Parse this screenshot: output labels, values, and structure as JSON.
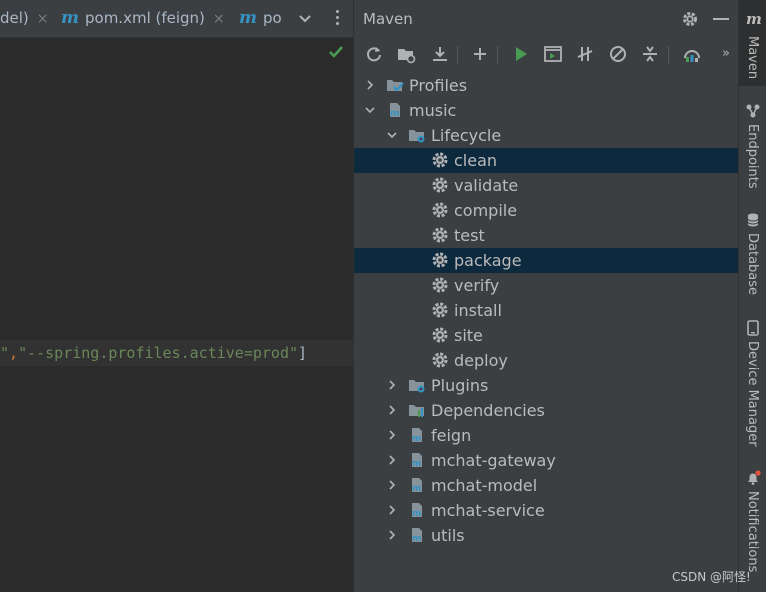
{
  "editor": {
    "tabs": [
      {
        "label": "del)",
        "close": "×"
      },
      {
        "logo": "m",
        "label": "pom.xml (feign)",
        "close": "×"
      },
      {
        "logo": "m",
        "label": "po"
      }
    ],
    "code_line": {
      "part1": "\"",
      "part2": ",",
      "part3": "\"--spring.profiles.active=prod\"",
      "part4": "]"
    }
  },
  "maven": {
    "title": "Maven",
    "toolbar_more": "»",
    "tree": [
      {
        "label": "Profiles"
      },
      {
        "label": "music"
      },
      {
        "label": "Lifecycle"
      },
      {
        "label": "clean"
      },
      {
        "label": "validate"
      },
      {
        "label": "compile"
      },
      {
        "label": "test"
      },
      {
        "label": "package"
      },
      {
        "label": "verify"
      },
      {
        "label": "install"
      },
      {
        "label": "site"
      },
      {
        "label": "deploy"
      },
      {
        "label": "Plugins"
      },
      {
        "label": "Dependencies"
      },
      {
        "label": "feign"
      },
      {
        "label": "mchat-gateway"
      },
      {
        "label": "mchat-model"
      },
      {
        "label": "mchat-service"
      },
      {
        "label": "utils"
      }
    ]
  },
  "right_strip": {
    "maven_logo": "m",
    "maven": "Maven",
    "endpoints": "Endpoints",
    "database": "Database",
    "device_manager": "Device Manager",
    "notifications": "Notifications"
  },
  "watermark": "CSDN @阿怪!",
  "colors": {
    "panel_bg": "#3c3f41",
    "editor_bg": "#2b2b2b",
    "selection": "#0d293e",
    "run_green": "#499c54",
    "maven_blue": "#3592c4"
  }
}
